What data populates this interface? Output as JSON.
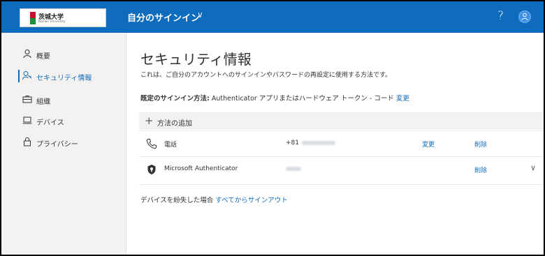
{
  "header": {
    "org_name": "茨城大学",
    "org_sub": "Ibaraki University",
    "title": "自分のサインイン",
    "chevron": "∨",
    "help": "?",
    "colors": {
      "header_bg": "#0f6cbd",
      "link": "#0f6cbd"
    }
  },
  "sidebar": {
    "items": [
      {
        "label": "概要",
        "icon": "person-icon"
      },
      {
        "label": "セキュリティ情報",
        "icon": "security-info-icon",
        "active": true
      },
      {
        "label": "組織",
        "icon": "briefcase-icon"
      },
      {
        "label": "デバイス",
        "icon": "laptop-icon"
      },
      {
        "label": "プライバシー",
        "icon": "lock-icon"
      }
    ]
  },
  "main": {
    "title": "セキュリティ情報",
    "description": "これは、ご自分のアカウントへのサインインやパスワードの再設定に使用する方法です。",
    "default_label": "既定のサインイン方法:",
    "default_value": " Authenticator アプリまたはハードウェア トークン - コード ",
    "default_change": "変更",
    "add_method": "方法の追加",
    "add_icon": "+",
    "methods": [
      {
        "name": "電話",
        "detail": "+81",
        "icon": "phone-icon",
        "change": "変更",
        "delete": "削除"
      },
      {
        "name": "Microsoft Authenticator",
        "detail": "",
        "icon": "authenticator-icon",
        "delete": "削除",
        "expand": "∨"
      }
    ],
    "lost_prefix": "デバイスを紛失した場合 ",
    "lost_link": "すべてからサインアウト"
  }
}
